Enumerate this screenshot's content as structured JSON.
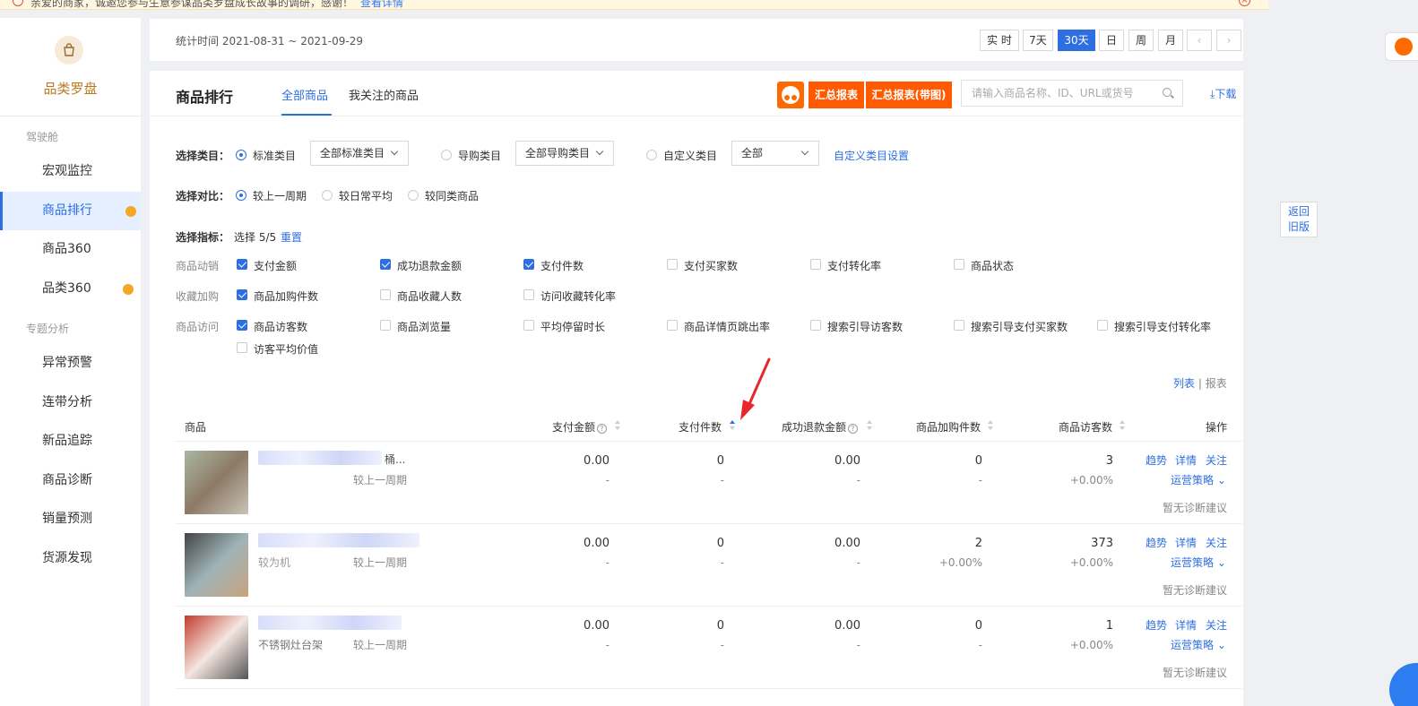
{
  "notice": {
    "text": "亲爱的商家，诚邀您参与生意参谋品类罗盘成长故事的调研，感谢！",
    "link": "查看详情"
  },
  "sidebar": {
    "title": "品类罗盘",
    "group1": "驾驶舱",
    "group2": "专题分析",
    "items": [
      {
        "label": "宏观监控"
      },
      {
        "label": "商品排行"
      },
      {
        "label": "商品360"
      },
      {
        "label": "品类360"
      },
      {
        "label": "异常预警"
      },
      {
        "label": "连带分析"
      },
      {
        "label": "新品追踪"
      },
      {
        "label": "商品诊断"
      },
      {
        "label": "销量预测"
      },
      {
        "label": "货源发现"
      }
    ]
  },
  "topbar": {
    "stat_time": "统计时间 2021-08-31 ~ 2021-09-29",
    "buttons": [
      "实 时",
      "7天",
      "30天",
      "日",
      "周",
      "月"
    ],
    "active": "30天"
  },
  "header": {
    "title": "商品排行",
    "tabs": [
      "全部商品",
      "我关注的商品"
    ],
    "report_btn": "汇总报表",
    "report_img_btn": "汇总报表(带图)",
    "search_placeholder": "请输入商品名称、ID、URL或货号",
    "download": "下载"
  },
  "filters": {
    "category_label": "选择类目：",
    "cat_std": "标准类目",
    "cat_std_select": "全部标准类目",
    "cat_guide": "导购类目",
    "cat_guide_select": "全部导购类目",
    "cat_custom": "自定义类目",
    "cat_custom_select": "全部",
    "cat_custom_link": "自定义类目设置",
    "compare_label": "选择对比：",
    "cmp_options": [
      "较上一周期",
      "较日常平均",
      "较同类商品"
    ],
    "metrics_label": "选择指标：",
    "metrics_count": "选择 5/5",
    "metrics_reset": "重置",
    "groups": [
      {
        "name": "商品动销",
        "items": [
          {
            "label": "支付金额",
            "checked": true
          },
          {
            "label": "成功退款金额",
            "checked": true
          },
          {
            "label": "支付件数",
            "checked": true
          },
          {
            "label": "支付买家数",
            "checked": false
          },
          {
            "label": "支付转化率",
            "checked": false
          },
          {
            "label": "商品状态",
            "checked": false
          }
        ]
      },
      {
        "name": "收藏加购",
        "items": [
          {
            "label": "商品加购件数",
            "checked": true
          },
          {
            "label": "商品收藏人数",
            "checked": false
          },
          {
            "label": "访问收藏转化率",
            "checked": false
          }
        ]
      },
      {
        "name": "商品访问",
        "items": [
          {
            "label": "商品访客数",
            "checked": true
          },
          {
            "label": "商品浏览量",
            "checked": false
          },
          {
            "label": "平均停留时长",
            "checked": false
          },
          {
            "label": "商品详情页跳出率",
            "checked": false
          },
          {
            "label": "搜索引导访客数",
            "checked": false
          },
          {
            "label": "搜索引导支付买家数",
            "checked": false
          },
          {
            "label": "搜索引导支付转化率",
            "checked": false
          },
          {
            "label": "访客平均价值",
            "checked": false
          }
        ]
      }
    ]
  },
  "view_toggle": {
    "list": "列表",
    "sep": "|",
    "report": "报表"
  },
  "table": {
    "headers": {
      "product": "商品",
      "pay_amount": "支付金额",
      "pay_count": "支付件数",
      "refund": "成功退款金额",
      "cart": "商品加购件数",
      "visitors": "商品访客数",
      "ops": "操作"
    },
    "rows": [
      {
        "name_tail": "桶...",
        "name": "",
        "compare": "较上一周期",
        "pay_amount": "0.00",
        "pay_amount_cmp": "-",
        "pay_count": "0",
        "pay_count_cmp": "-",
        "refund": "0.00",
        "refund_cmp": "-",
        "cart": "0",
        "cart_cmp": "-",
        "visitors": "3",
        "visitors_cmp": "+0.00%"
      },
      {
        "name_tail": "",
        "name": "较为机",
        "compare": "较上一周期",
        "pay_amount": "0.00",
        "pay_amount_cmp": "-",
        "pay_count": "0",
        "pay_count_cmp": "-",
        "refund": "0.00",
        "refund_cmp": "-",
        "cart": "2",
        "cart_cmp": "+0.00%",
        "visitors": "373",
        "visitors_cmp": "+0.00%"
      },
      {
        "name_tail": "",
        "name": "不锈钢灶台架",
        "compare": "较上一周期",
        "pay_amount": "0.00",
        "pay_amount_cmp": "-",
        "pay_count": "0",
        "pay_count_cmp": "-",
        "refund": "0.00",
        "refund_cmp": "-",
        "cart": "0",
        "cart_cmp": "-",
        "visitors": "1",
        "visitors_cmp": "+0.00%"
      }
    ],
    "ops": {
      "trend": "趋势",
      "detail": "详情",
      "follow": "关注",
      "strategy": "运营策略",
      "no_advice": "暂无诊断建议"
    }
  },
  "side": {
    "old_version": [
      "返回",
      "旧版"
    ]
  },
  "colors": {
    "accent": "#2d6fe0",
    "orange": "#ff5a00",
    "dot": "#f5a623",
    "arrow": "#e8262b"
  }
}
